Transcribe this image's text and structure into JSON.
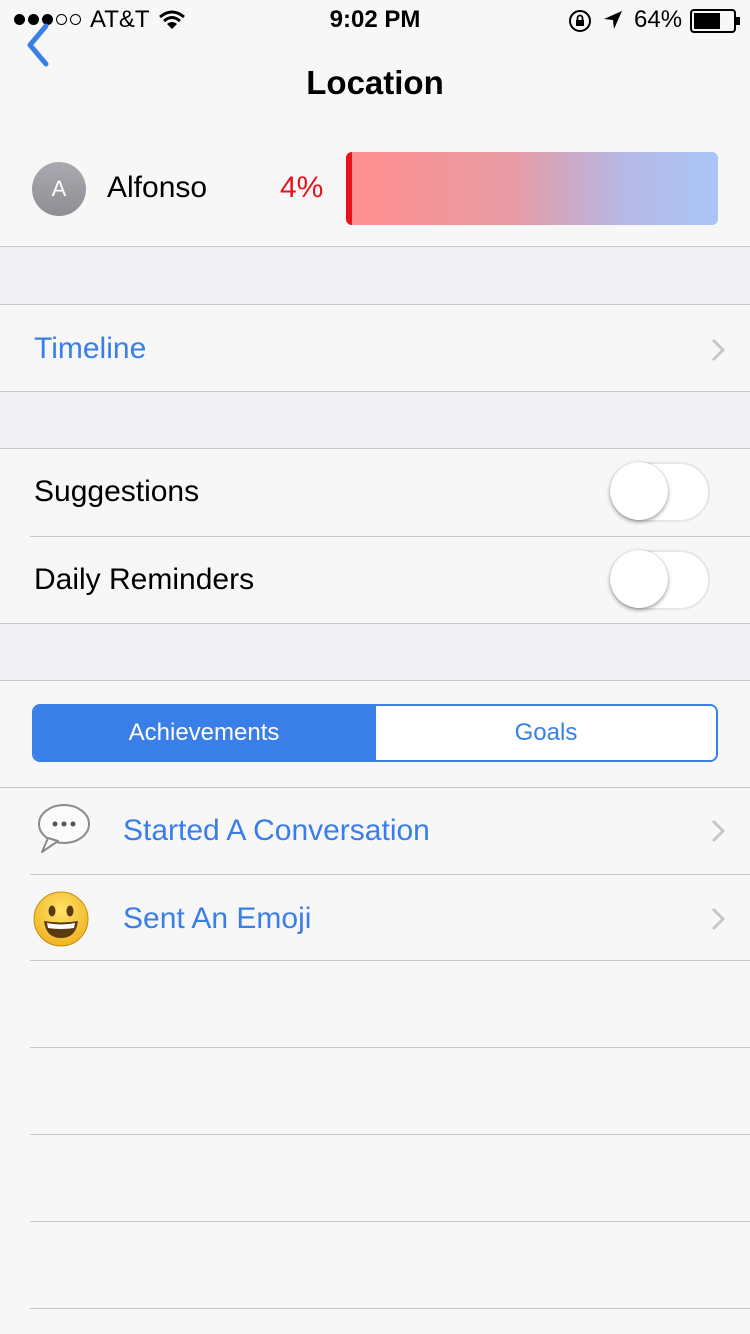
{
  "status_bar": {
    "carrier": "AT&T",
    "signal_bars_filled": 3,
    "signal_bars_total": 5,
    "time": "9:02 PM",
    "battery": "64%",
    "icons": [
      "wifi-icon",
      "rotation-lock-icon",
      "location-arrow-icon",
      "battery-icon"
    ]
  },
  "nav": {
    "title": "Location",
    "back_icon": "chevron-left-icon"
  },
  "profile": {
    "avatar_initial": "A",
    "name": "Alfonso",
    "progress_label": "4%",
    "progress_value": 0.04
  },
  "timeline": {
    "label": "Timeline"
  },
  "settings": [
    {
      "label": "Suggestions",
      "on": false
    },
    {
      "label": "Daily Reminders",
      "on": false
    }
  ],
  "segmented": {
    "options": [
      "Achievements",
      "Goals"
    ],
    "selected": "Achievements"
  },
  "achievements": [
    {
      "label": "Started A Conversation",
      "icon": "speech-bubble-icon"
    },
    {
      "label": "Sent An Emoji",
      "icon": "smiley-emoji-icon"
    }
  ],
  "colors": {
    "accent": "#3a7ee8",
    "progress_red": "#e8141b",
    "background": "#efeff4"
  }
}
